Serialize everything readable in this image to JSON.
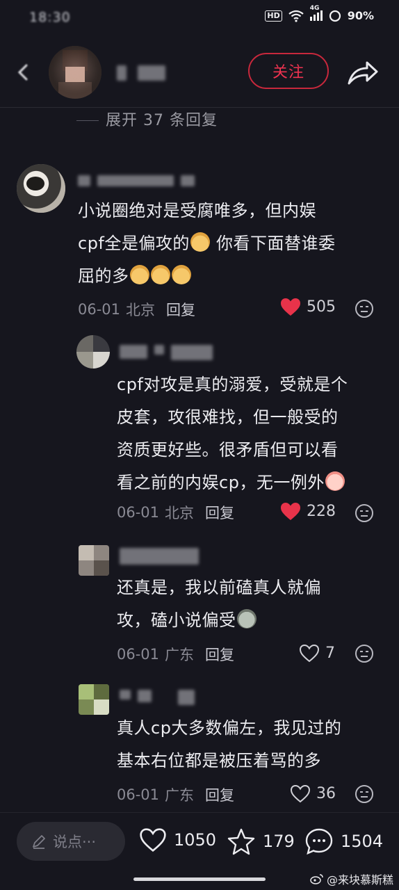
{
  "status_bar": {
    "time": "18:30",
    "network": "4G",
    "battery": "90%",
    "hd_label": "HD"
  },
  "header": {
    "follow_label": "关注"
  },
  "thread": {
    "expand_label": "展开 37 条回复"
  },
  "comments": [
    {
      "text_line1": "小说圈绝对是受腐唯多，但内娱",
      "text_line2": "cpf全是偏攻的",
      "text_line2b": " 你看下面替谁委",
      "text_line3": "屈的多",
      "date": "06-01",
      "location": "北京",
      "reply_label": "回复",
      "likes": "505",
      "liked": true
    },
    {
      "text_line1": "cpf对攻是真的溺爱，受就是个",
      "text_line2": "皮套，攻很难找，但一般受的",
      "text_line3": "资质更好些。很矛盾但可以看",
      "text_line4": "看之前的内娱cp，无一例外",
      "date": "06-01",
      "location": "北京",
      "reply_label": "回复",
      "likes": "228",
      "liked": true
    },
    {
      "text_line1": "还真是，我以前磕真人就偏",
      "text_line2": "攻，磕小说偏受",
      "date": "06-01",
      "location": "广东",
      "reply_label": "回复",
      "likes": "7",
      "liked": false
    },
    {
      "text_line1": "真人cp大多数偏左，我见过的",
      "text_line2": "基本右位都是被压着骂的多",
      "date": "06-01",
      "location": "广东",
      "reply_label": "回复",
      "likes": "36",
      "liked": false
    }
  ],
  "bottom_bar": {
    "input_placeholder": "说点···",
    "likes": "1050",
    "favorites": "179",
    "comments": "1504"
  },
  "watermark": "@来块慕斯糕",
  "colors": {
    "background": "#16161e",
    "accent_red": "#ee3350",
    "heart_red": "#e8334a"
  }
}
